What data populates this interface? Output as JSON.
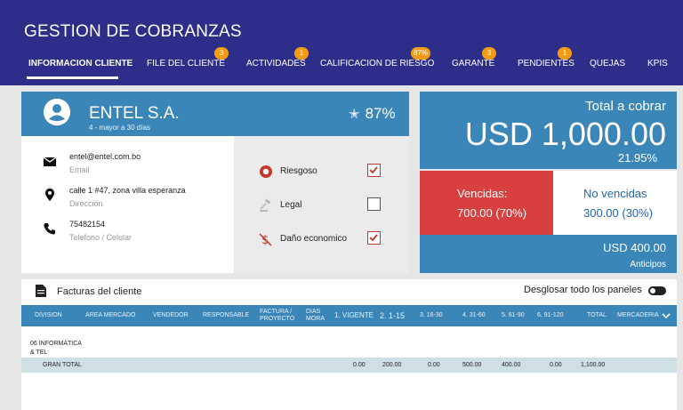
{
  "app": {
    "title": "GESTION DE COBRANZAS"
  },
  "tabs": [
    {
      "label": "INFORMACION  CLIENTE",
      "badge": ""
    },
    {
      "label": "FILE DEL CLIENTE",
      "badge": "3"
    },
    {
      "label": "ACTIVIDADES",
      "badge": "1"
    },
    {
      "label": "CALIFICACION DE RIESGO",
      "badge": "87%"
    },
    {
      "label": "GARANTE",
      "badge": "3"
    },
    {
      "label": "PENDIENTES",
      "badge": "1"
    },
    {
      "label": "QUEJAS",
      "badge": ""
    },
    {
      "label": "KPIS",
      "badge": ""
    }
  ],
  "client": {
    "name": "ENTEL S.A.",
    "subtitle": "4 - mayor a 30 días",
    "rating": "87%",
    "email": {
      "value": "entel@entel.com.bo",
      "label": "Email"
    },
    "address": {
      "value": "calle 1 #47, zona villa esperanza",
      "label": "Dirección"
    },
    "phone": {
      "value": "75482154",
      "label": "Telefono / Celular"
    }
  },
  "flags": [
    {
      "label": "Riesgoso",
      "checked": true
    },
    {
      "label": "Legal",
      "checked": false
    },
    {
      "label": "Daño economico",
      "checked": true
    }
  ],
  "totals": {
    "label": "Total a cobrar",
    "amount": "USD 1,000.00",
    "pct": "21.95%",
    "vencidas_label": "Vencidas:",
    "vencidas_value": "700.00 (70%)",
    "no_vencidas_label": "No vencidas",
    "no_vencidas_value": "300.00 (30%)",
    "anticipos_amount": "USD 400.00",
    "anticipos_label": "Anticipos"
  },
  "invoices": {
    "title": "Facturas del cliente",
    "toggle_label": "Desglosar todo los paneles",
    "columns": [
      "DIVISION",
      "AREA MERCADO",
      "VENDEDOR",
      "RESPONSABLE",
      "FACTURA / PROYECTO",
      "DIAS MORA",
      "1. VIGENTE",
      "2. 1-15",
      "3. 16-30",
      "4. 31-60",
      "5. 61-90",
      "6. 91-120",
      "TOTAL",
      "MERCADERIA"
    ],
    "division_row": "06 INFORMÁTICA & TEL",
    "total_row": {
      "label": "GRAN TOTAL",
      "values": [
        "0.00",
        "200.00",
        "0.00",
        "500.00",
        "400.00",
        "0.00",
        "1,100.00"
      ]
    }
  },
  "colors": {
    "header": "#2c2e8a",
    "accent": "#3a86b8",
    "danger": "#d84040",
    "badge": "#f39c12"
  }
}
